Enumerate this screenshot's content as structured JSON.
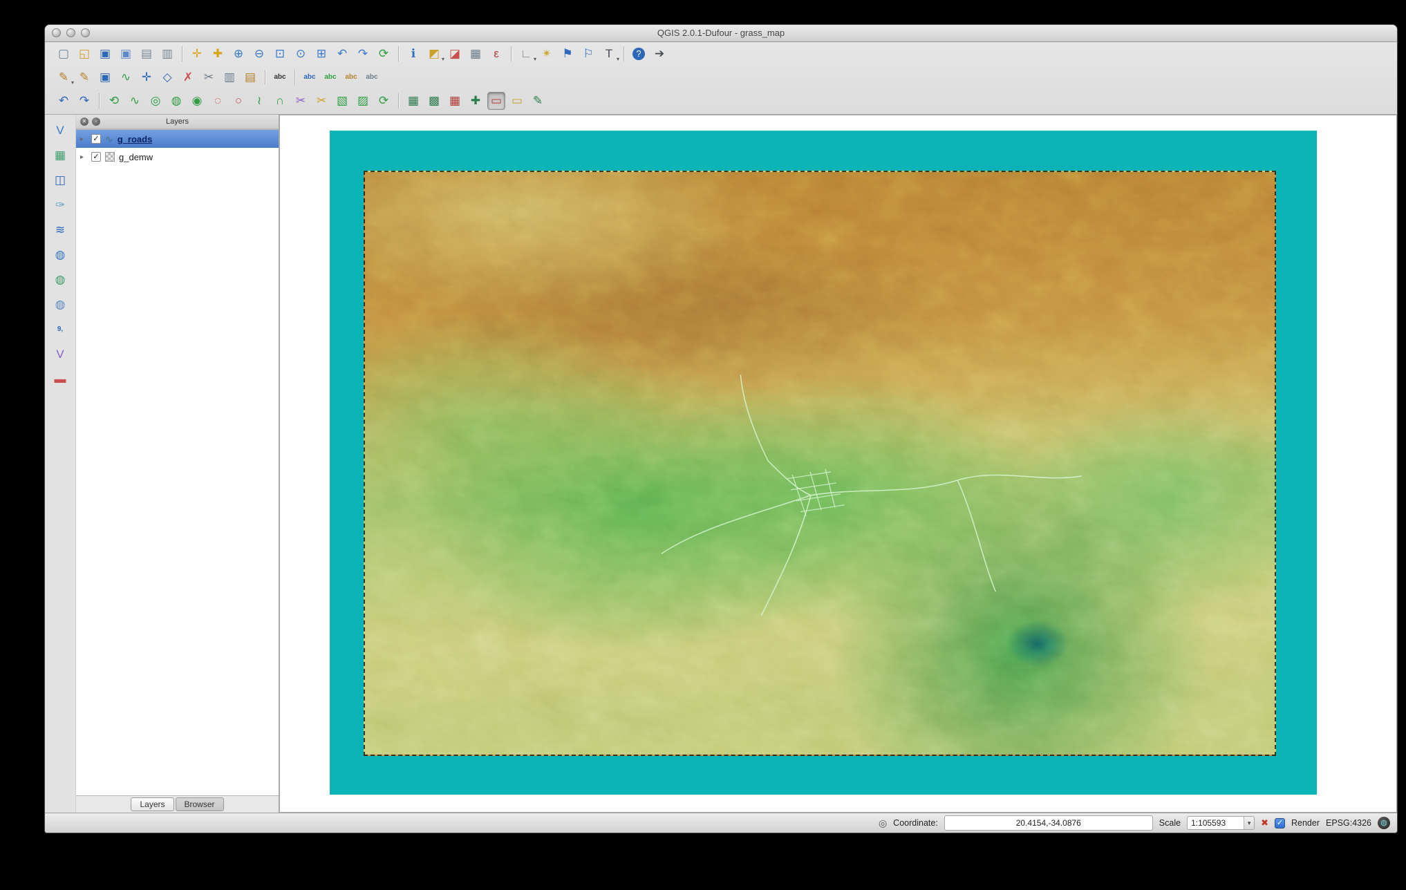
{
  "window": {
    "title": "QGIS 2.0.1-Dufour - grass_map"
  },
  "toolbars": {
    "row1": [
      {
        "n": "new-project",
        "g": "▢",
        "c": "#6b7a89"
      },
      {
        "n": "open-project",
        "g": "◱",
        "c": "#d49a2a"
      },
      {
        "n": "save-project",
        "g": "▣",
        "c": "#2e66b8"
      },
      {
        "n": "save-project-as",
        "g": "▣",
        "c": "#5d87c6"
      },
      {
        "n": "new-print-composer",
        "g": "▤",
        "c": "#7a8691"
      },
      {
        "n": "composer-manager",
        "g": "▥",
        "c": "#7a8691"
      },
      {
        "sep": true
      },
      {
        "n": "pan-map",
        "g": "✛",
        "c": "#d9a51f"
      },
      {
        "n": "pan-to-selection",
        "g": "✚",
        "c": "#d9a51f"
      },
      {
        "n": "zoom-in",
        "g": "⊕",
        "c": "#3a78c9"
      },
      {
        "n": "zoom-out",
        "g": "⊖",
        "c": "#3a78c9"
      },
      {
        "n": "zoom-full",
        "g": "⊡",
        "c": "#3a78c9"
      },
      {
        "n": "zoom-to-selection",
        "g": "⊙",
        "c": "#3a78c9"
      },
      {
        "n": "zoom-to-layer",
        "g": "⊞",
        "c": "#3a78c9"
      },
      {
        "n": "zoom-last",
        "g": "↶",
        "c": "#3a78c9"
      },
      {
        "n": "zoom-next",
        "g": "↷",
        "c": "#3a78c9"
      },
      {
        "n": "refresh-map",
        "g": "⟳",
        "c": "#2f9e44"
      },
      {
        "sep": true
      },
      {
        "n": "identify-features",
        "g": "ℹ",
        "c": "#2f6fc0"
      },
      {
        "n": "select-features",
        "g": "◩",
        "c": "#c9a227",
        "dd": true
      },
      {
        "n": "deselect-features",
        "g": "◪",
        "c": "#c94f4f"
      },
      {
        "n": "open-attribute-table",
        "g": "▦",
        "c": "#6b7a89"
      },
      {
        "n": "field-calculator",
        "g": "ε",
        "c": "#b23a3a"
      },
      {
        "sep": true
      },
      {
        "n": "measure-line",
        "g": "∟",
        "c": "#7a8691",
        "dd": true
      },
      {
        "n": "map-tips",
        "g": "✴",
        "c": "#c9a227"
      },
      {
        "n": "new-bookmark",
        "g": "⚑",
        "c": "#2e66b8"
      },
      {
        "n": "show-bookmarks",
        "g": "⚐",
        "c": "#2e66b8"
      },
      {
        "n": "text-annotation",
        "g": "T",
        "c": "#444a50",
        "dd": true
      },
      {
        "sep": true
      },
      {
        "n": "help-contents",
        "g": "?",
        "c": "#ffffff",
        "pill": true
      },
      {
        "n": "whats-this",
        "g": "➔",
        "c": "#444a50"
      }
    ],
    "row2": [
      {
        "n": "current-edits",
        "g": "✎",
        "c": "#b5802a",
        "dd": true
      },
      {
        "n": "toggle-editing",
        "g": "✎",
        "c": "#b5802a"
      },
      {
        "n": "save-layer-edits",
        "g": "▣",
        "c": "#2e66b8"
      },
      {
        "n": "add-feature",
        "g": "∿",
        "c": "#2f9e44"
      },
      {
        "n": "move-feature",
        "g": "✛",
        "c": "#2e66b8"
      },
      {
        "n": "node-tool",
        "g": "◇",
        "c": "#2e66b8"
      },
      {
        "n": "delete-selected",
        "g": "✗",
        "c": "#c94f4f"
      },
      {
        "n": "cut-features",
        "g": "✂",
        "c": "#6b7a89"
      },
      {
        "n": "copy-features",
        "g": "▥",
        "c": "#6b7a89"
      },
      {
        "n": "paste-features",
        "g": "▤",
        "c": "#b5802a"
      },
      {
        "sep": true
      },
      {
        "n": "layer-labeling-options",
        "g": "abc",
        "c": "#333333",
        "small": true
      },
      {
        "sep": true
      },
      {
        "n": "label-properties",
        "g": "abc",
        "c": "#2e66b8",
        "small": true
      },
      {
        "n": "move-label",
        "g": "abc",
        "c": "#2f9e44",
        "small": true
      },
      {
        "n": "rotate-label",
        "g": "abc",
        "c": "#b5802a",
        "small": true
      },
      {
        "n": "change-label",
        "g": "abc",
        "c": "#6b7a89",
        "small": true
      }
    ],
    "row3": [
      {
        "n": "undo",
        "g": "↶",
        "c": "#2e66b8"
      },
      {
        "n": "redo",
        "g": "↷",
        "c": "#2e66b8"
      },
      {
        "sep": true
      },
      {
        "n": "rotate-feature",
        "g": "⟲",
        "c": "#2f9e44"
      },
      {
        "n": "simplify-feature",
        "g": "∿",
        "c": "#2f9e44"
      },
      {
        "n": "add-ring",
        "g": "◎",
        "c": "#2f9e44"
      },
      {
        "n": "add-part",
        "g": "◍",
        "c": "#2f9e44"
      },
      {
        "n": "fill-ring",
        "g": "◉",
        "c": "#2f9e44"
      },
      {
        "n": "delete-ring",
        "g": "◌",
        "c": "#c94f4f"
      },
      {
        "n": "delete-part",
        "g": "○",
        "c": "#c94f4f"
      },
      {
        "n": "offset-curve",
        "g": "≀",
        "c": "#2f9e44"
      },
      {
        "n": "reshape-features",
        "g": "∩",
        "c": "#2f9e44"
      },
      {
        "n": "split-parts",
        "g": "✂",
        "c": "#8a5fc9"
      },
      {
        "n": "split-features",
        "g": "✂",
        "c": "#c9a227"
      },
      {
        "n": "merge-features",
        "g": "▧",
        "c": "#2f9e44"
      },
      {
        "n": "merge-attributes",
        "g": "▨",
        "c": "#2f9e44"
      },
      {
        "n": "rotate-point-symbols",
        "g": "⟳",
        "c": "#2f9e44"
      },
      {
        "sep": true
      },
      {
        "n": "open-mapset",
        "g": "▦",
        "c": "#2f7d4f"
      },
      {
        "n": "new-mapset",
        "g": "▩",
        "c": "#2f7d4f"
      },
      {
        "n": "close-mapset",
        "g": "▦",
        "c": "#b23a3a"
      },
      {
        "n": "open-grass-tools",
        "g": "✚",
        "c": "#2f7d4f"
      },
      {
        "n": "display-current-grass-region",
        "g": "▭",
        "c": "#b23a3a",
        "active": true
      },
      {
        "n": "edit-current-grass-region",
        "g": "▭",
        "c": "#c9a227"
      },
      {
        "n": "edit-grass-vector",
        "g": "✎",
        "c": "#2f7d4f"
      }
    ],
    "side": [
      {
        "n": "add-vector-layer",
        "g": "V",
        "c": "#3a78c9"
      },
      {
        "n": "add-raster-layer",
        "g": "▦",
        "c": "#3f9d6b"
      },
      {
        "n": "add-postgis-layer",
        "g": "◫",
        "c": "#2e66b8"
      },
      {
        "n": "add-spatialite-layer",
        "g": "✑",
        "c": "#6aa7c4"
      },
      {
        "n": "add-mssql-layer",
        "g": "≋",
        "c": "#2e66b8"
      },
      {
        "n": "add-wms-layer",
        "g": "◍",
        "c": "#3a78c9"
      },
      {
        "n": "add-wcs-layer",
        "g": "◍",
        "c": "#3f9d6b"
      },
      {
        "n": "add-wfs-layer",
        "g": "◍",
        "c": "#5d87c6"
      },
      {
        "n": "add-delimited-text-layer",
        "g": "9,",
        "c": "#2e66b8",
        "small": true
      },
      {
        "n": "new-shapefile-layer",
        "g": "V",
        "c": "#8a5fc9"
      },
      {
        "n": "remove-layer",
        "g": "▬",
        "c": "#c94f4f"
      }
    ]
  },
  "layers_panel": {
    "title": "Layers",
    "items": [
      {
        "label": "g_roads",
        "type": "vector",
        "checked": true,
        "selected": true
      },
      {
        "label": "g_demw",
        "type": "raster",
        "checked": true,
        "selected": false
      }
    ],
    "tabs": [
      {
        "label": "Layers",
        "active": true
      },
      {
        "label": "Browser",
        "active": false
      }
    ]
  },
  "statusbar": {
    "coordinate_label": "Coordinate:",
    "coordinate_value": "20.4154,-34.0876",
    "scale_label": "Scale",
    "scale_value": "1:105593",
    "render_label": "Render",
    "crs_label": "EPSG:4326"
  },
  "map": {
    "frame_color": "#0ab3b6",
    "selection_color": "#4a7ccc",
    "terrain_palette": [
      "#bf8536",
      "#cd9a46",
      "#cec76d",
      "#8fc767",
      "#4aa24e",
      "#d3d680",
      "#106969"
    ]
  }
}
